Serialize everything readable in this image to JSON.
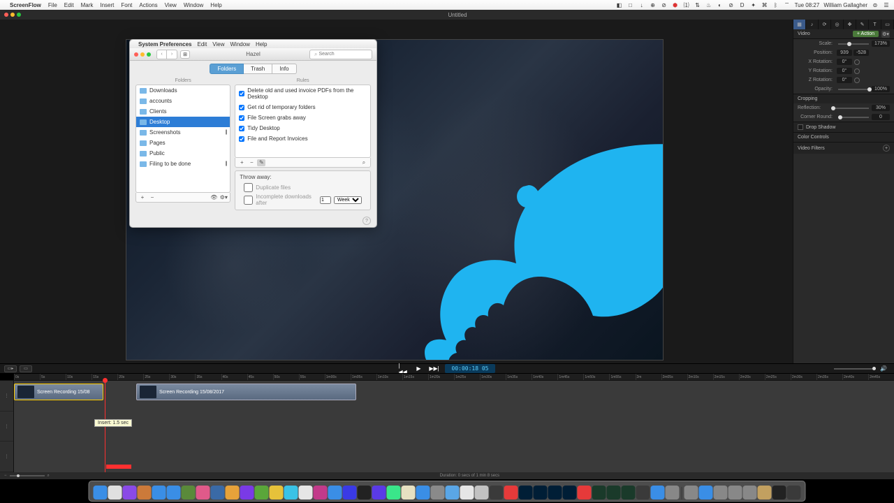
{
  "menubar": {
    "app": "ScreenFlow",
    "items": [
      "File",
      "Edit",
      "Mark",
      "Insert",
      "Font",
      "Actions",
      "View",
      "Window",
      "Help"
    ],
    "clock": "Tue 08:27",
    "user": "William Gallagher"
  },
  "document": {
    "title": "Untitled"
  },
  "sysprefs": {
    "menubar": {
      "app": "System Preferences",
      "items": [
        "Edit",
        "View",
        "Window",
        "Help"
      ]
    },
    "toolbar": {
      "title": "Hazel",
      "search_placeholder": "Search"
    },
    "tabs": [
      "Folders",
      "Trash",
      "Info"
    ],
    "active_tab": 0,
    "folders_header": "Folders",
    "rules_header": "Rules",
    "folders": [
      {
        "name": "Downloads",
        "paused": false
      },
      {
        "name": "accounts",
        "paused": false
      },
      {
        "name": "Clients",
        "paused": false
      },
      {
        "name": "Desktop",
        "paused": false,
        "selected": true
      },
      {
        "name": "Screenshots",
        "paused": true
      },
      {
        "name": "Pages",
        "paused": false
      },
      {
        "name": "Public",
        "paused": false
      },
      {
        "name": "Filing to be done",
        "paused": true
      }
    ],
    "rules": [
      {
        "label": "Delete old and used invoice PDFs from the Desktop",
        "checked": true
      },
      {
        "label": "Get rid of temporary folders",
        "checked": true
      },
      {
        "label": "File Screen grabs away",
        "checked": true
      },
      {
        "label": "Tidy Desktop",
        "checked": true
      },
      {
        "label": "File and Report Invoices",
        "checked": true
      }
    ],
    "throw_away": {
      "header": "Throw away:",
      "duplicate": "Duplicate files",
      "incomplete": "Incomplete downloads after",
      "period_value": "1",
      "period_unit": "Week"
    }
  },
  "inspector": {
    "tab_title": "Video",
    "add_action": "+ Action",
    "scale": {
      "label": "Scale:",
      "value": "173%",
      "pos": 30
    },
    "position": {
      "label": "Position:",
      "x": "939",
      "y": "-528"
    },
    "xrot": {
      "label": "X Rotation:",
      "value": "0°",
      "pos": 0
    },
    "yrot": {
      "label": "Y Rotation:",
      "value": "0°",
      "pos": 0
    },
    "zrot": {
      "label": "Z Rotation:",
      "value": "0°",
      "pos": 0
    },
    "opacity": {
      "label": "Opacity:",
      "value": "100%",
      "pos": 100
    },
    "sections": {
      "cropping": "Cropping",
      "reflection": {
        "label": "Reflection:",
        "value": "30%",
        "pos": 0
      },
      "corner": {
        "label": "Corner Round:",
        "value": "0",
        "pos": 0
      },
      "shadow": "Drop Shadow",
      "color": "Color Controls",
      "filters": "Video Filters"
    }
  },
  "playback": {
    "timecode": "00:00:18 05"
  },
  "ruler": [
    "0s",
    "5s",
    "10s",
    "15s",
    "20s",
    "25s",
    "30s",
    "35s",
    "40s",
    "45s",
    "50s",
    "55s",
    "1m00s",
    "1m05s",
    "1m10s",
    "1m15s",
    "1m20s",
    "1m25s",
    "1m30s",
    "1m35s",
    "1m40s",
    "1m45s",
    "1m50s",
    "1m55s",
    "2m",
    "2m05s",
    "2m10s",
    "2m15s",
    "2m20s",
    "2m25s",
    "2m30s",
    "2m35s",
    "2m40s",
    "2m45s"
  ],
  "timeline": {
    "clip1": "Screen Recording 15/08",
    "clip2": "Screen Recording 15/08/2017",
    "tooltip": "Insert: 1.5 sec",
    "duration": "Duration: 0 secs of 1 min 8 secs"
  },
  "dock_colors": [
    "#3a8ee6",
    "#e0e0e0",
    "#8a4ae6",
    "#cc7a3a",
    "#3a8ee6",
    "#3a8ee6",
    "#5a8a3a",
    "#e05a8a",
    "#3a6aa6",
    "#e6a23a",
    "#7a3ae6",
    "#5aa63a",
    "#e6c23a",
    "#3ac2e6",
    "#e6e6e6",
    "#c23a8a",
    "#3a8ee6",
    "#3a3ae6",
    "#222",
    "#5a3ae6",
    "#3ae68a",
    "#e6e0c2",
    "#3a8ee6",
    "#8a8a8a",
    "#5aa6e6",
    "#e6e6e6",
    "#c2c2c2",
    "#3a3a3a",
    "#e63a3a",
    "#001e36",
    "#001e36",
    "#001e36",
    "#001e36",
    "#e63a3a",
    "#1a3a2a",
    "#1a3a2a",
    "#1a3a2a",
    "#3a3a3a",
    "#3a8ee6",
    "#888",
    "#888",
    "#3a8ee6",
    "#888",
    "#888",
    "#888",
    "#c2a060",
    "#222",
    "#3a3a3a"
  ]
}
